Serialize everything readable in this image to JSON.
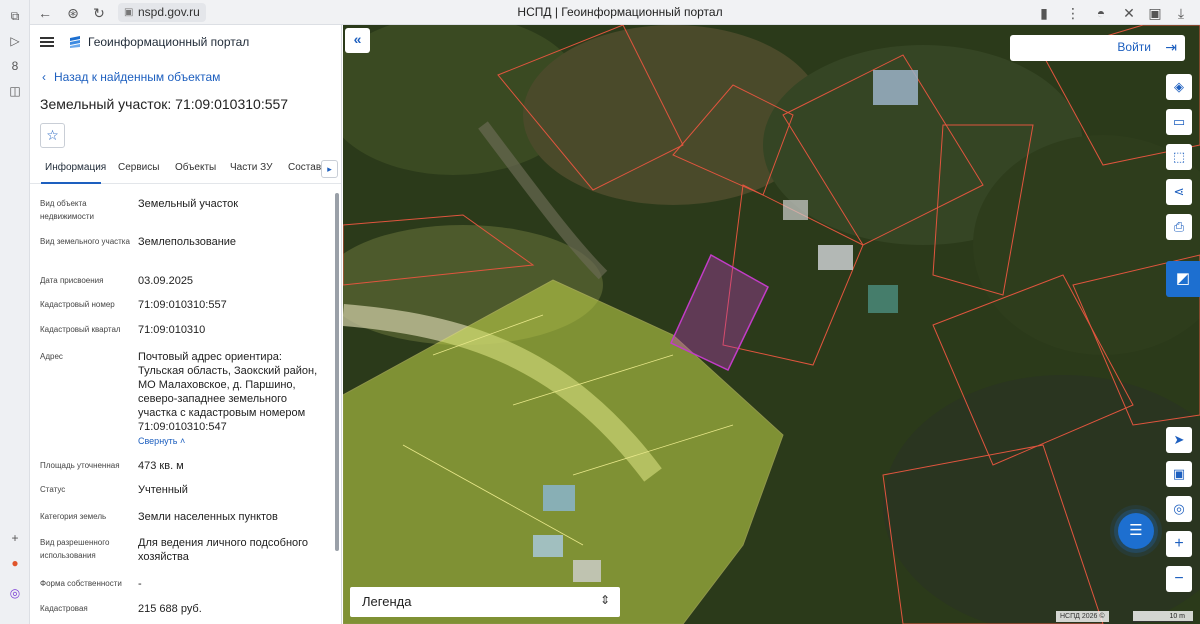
{
  "browser": {
    "url": "nspd.gov.ru",
    "tab_title": "НСПД | Геоинформационный портал"
  },
  "panel": {
    "portal_name": "Геоинформационный портал",
    "back_link": "Назад к найденным объектам",
    "title": "Земельный участок: 71:09:010310:557",
    "tabs": [
      "Информация",
      "Сервисы",
      "Объекты",
      "Части ЗУ",
      "Состав"
    ],
    "active_tab": "Информация",
    "collapse_label": "Свернуть",
    "fields": [
      {
        "label": "Вид объекта недвижимости",
        "value": "Земельный участок"
      },
      {
        "label": "Вид земельного участка",
        "value": "Землепользование"
      },
      {
        "label": "Дата присвоения",
        "value": "03.09.2025"
      },
      {
        "label": "Кадастровый номер",
        "value": "71:09:010310:557"
      },
      {
        "label": "Кадастровый квартал",
        "value": "71:09:010310"
      },
      {
        "label": "Адрес",
        "value": "Почтовый адрес ориентира: Тульская область, Заокский район, МО Малаховское, д. Паршино, северо-западнее земельного участка с кадастровым номером 71:09:010310:547"
      },
      {
        "label": "Площадь уточненная",
        "value": "473 кв. м"
      },
      {
        "label": "Статус",
        "value": "Учтенный"
      },
      {
        "label": "Категория земель",
        "value": "Земли населенных пунктов"
      },
      {
        "label": "Вид разрешенного использования",
        "value": "Для ведения личного подсобного хозяйства"
      },
      {
        "label": "Форма собственности",
        "value": "-"
      },
      {
        "label": "Кадастровая",
        "value": "215 688 руб."
      }
    ]
  },
  "map": {
    "login_label": "Войти",
    "legend_label": "Легенда",
    "attribution": "НСПД 2026 ©",
    "scale_label": "10 m",
    "tools": [
      "layers-icon",
      "ruler-icon",
      "select-area-icon",
      "share-icon",
      "print-icon"
    ],
    "bottom_tools": [
      "locate-icon",
      "basemap-icon",
      "geolocation-icon",
      "zoom-in-icon",
      "zoom-out-icon"
    ],
    "colors": {
      "accent": "#1d5fbf",
      "selected_parcel": "#c23cc7",
      "parcel_border": "#e0553e",
      "zone_fill": "#c5d84a"
    }
  }
}
